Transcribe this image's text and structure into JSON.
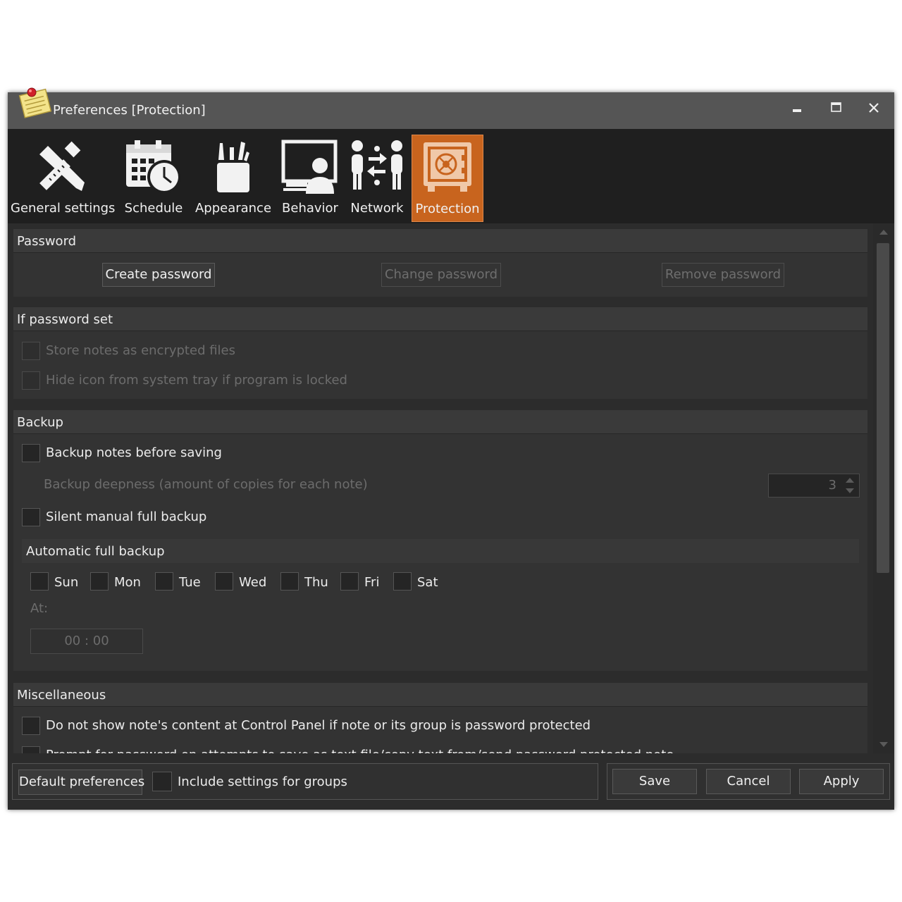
{
  "window": {
    "title": "Preferences [Protection]"
  },
  "toolbar": {
    "items": [
      {
        "label": "General settings",
        "icon": "tools-icon"
      },
      {
        "label": "Schedule",
        "icon": "calendar-clock-icon"
      },
      {
        "label": "Appearance",
        "icon": "brushes-icon"
      },
      {
        "label": "Behavior",
        "icon": "monitor-user-icon"
      },
      {
        "label": "Network",
        "icon": "network-people-icon"
      },
      {
        "label": "Protection",
        "icon": "safe-icon"
      }
    ],
    "active": "Protection",
    "accent_color": "#c8641e"
  },
  "password": {
    "header": "Password",
    "create": "Create password",
    "change": "Change password",
    "remove": "Remove password"
  },
  "if_password": {
    "header": "If password set",
    "store_encrypted": "Store notes as encrypted files",
    "hide_icon": "Hide icon from system tray if program is locked"
  },
  "backup": {
    "header": "Backup",
    "before_saving": "Backup notes before saving",
    "deepness_label": "Backup deepness (amount of copies for each note)",
    "deepness_value": "3",
    "silent_manual": "Silent manual full backup",
    "auto_header": "Automatic full backup",
    "days": [
      "Sun",
      "Mon",
      "Tue",
      "Wed",
      "Thu",
      "Fri",
      "Sat"
    ],
    "at_label": "At:",
    "time_value": "00 : 00"
  },
  "misc": {
    "header": "Miscellaneous",
    "dont_show": "Do not show note's content at Control Panel if note or its group is password protected",
    "prompt": "Prompt for password on attempts to save as text file/copy text from/send password protected note"
  },
  "footer": {
    "default_prefs": "Default preferences",
    "include_groups": "Include settings for groups",
    "save": "Save",
    "cancel": "Cancel",
    "apply": "Apply"
  }
}
